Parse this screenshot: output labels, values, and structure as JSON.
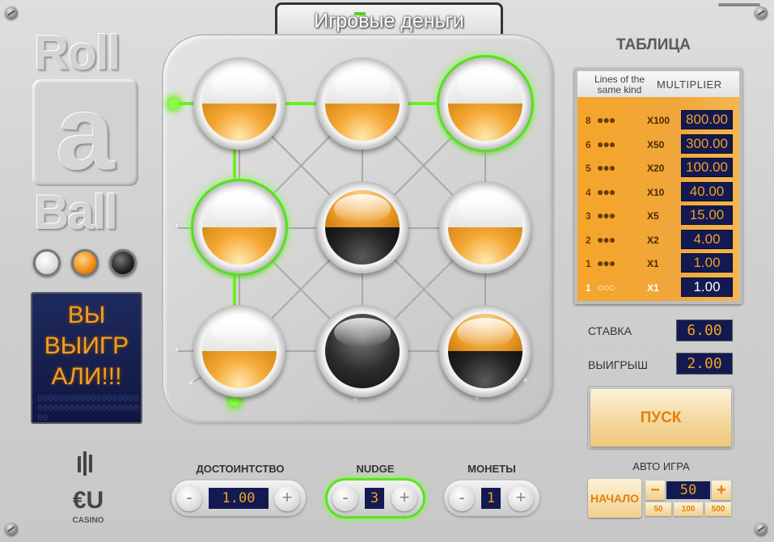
{
  "title": "Игровые деньги",
  "logo": {
    "word1": "Roll",
    "word2": "a",
    "word3": "Ball"
  },
  "selector_balls": [
    "white",
    "orange",
    "black"
  ],
  "win_message": {
    "line1": "ВЫ",
    "line2": "ВЫИГР",
    "line3": "АЛИ!!!",
    "dots": "0000000000000000000000000000000000000000"
  },
  "grid": [
    {
      "top": "w",
      "bottom": "o",
      "lit": false
    },
    {
      "top": "w",
      "bottom": "o",
      "lit": false
    },
    {
      "top": "w",
      "bottom": "o",
      "lit": true
    },
    {
      "top": "w",
      "bottom": "o",
      "lit": true
    },
    {
      "top": "o",
      "bottom": "k",
      "lit": false
    },
    {
      "top": "w",
      "bottom": "o",
      "lit": false
    },
    {
      "top": "w",
      "bottom": "o",
      "lit": false
    },
    {
      "top": "k",
      "bottom": "k",
      "lit": false
    },
    {
      "top": "o",
      "bottom": "k",
      "lit": false
    }
  ],
  "paytable": {
    "heading": "ТАБЛИЦА",
    "col1": "Lines of the same kind",
    "col2": "MULTIPLIER",
    "rows": [
      {
        "lines": "8",
        "dots": "●●●",
        "mult": "X100",
        "value": "800.00"
      },
      {
        "lines": "6",
        "dots": "●●●",
        "mult": "X50",
        "value": "300.00"
      },
      {
        "lines": "5",
        "dots": "●●●",
        "mult": "X20",
        "value": "100.00"
      },
      {
        "lines": "4",
        "dots": "●●●",
        "mult": "X10",
        "value": "40.00"
      },
      {
        "lines": "3",
        "dots": "●●●",
        "mult": "X5",
        "value": "15.00"
      },
      {
        "lines": "2",
        "dots": "●●●",
        "mult": "X2",
        "value": "4.00"
      },
      {
        "lines": "1",
        "dots": "●●●",
        "mult": "X1",
        "value": "1.00"
      },
      {
        "lines": "1",
        "dots": "○○○",
        "mult": "X1",
        "value": "1.00"
      }
    ]
  },
  "stake": {
    "label": "СТАВКА",
    "value": "6.00"
  },
  "win": {
    "label": "ВЫИГРЫШ",
    "value": "2.00"
  },
  "spin_label": "ПУСК",
  "controls": {
    "denomination": {
      "label": "ДОСТОИНТСТВО",
      "value": "1.00",
      "minus": "-",
      "plus": "+"
    },
    "nudge": {
      "label": "NUDGE",
      "value": "3",
      "minus": "-",
      "plus": "+"
    },
    "coins": {
      "label": "МОНЕТЫ",
      "value": "1",
      "minus": "-",
      "plus": "+"
    }
  },
  "auto": {
    "label": "АВТО ИГРА",
    "start": "НАЧАЛО",
    "minus": "−",
    "value": "50",
    "plus": "+",
    "presets": [
      "50",
      "100",
      "500"
    ]
  },
  "provider": {
    "name": "€U",
    "sub": "CASINO"
  }
}
